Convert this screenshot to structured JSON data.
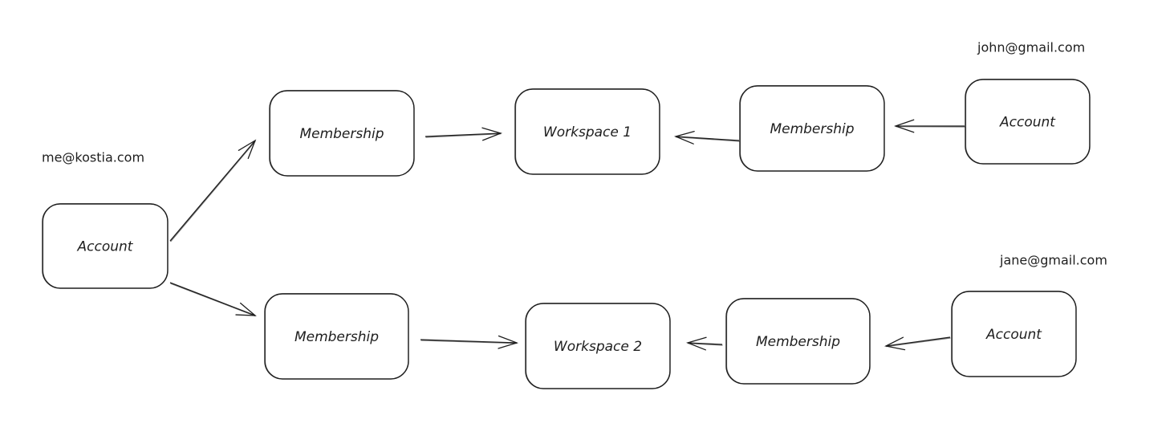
{
  "diagram": {
    "stroke_color": "#1e1e1e",
    "background": "#ffffff",
    "nodes": [
      {
        "id": "account-me",
        "label": "Account",
        "type": "account"
      },
      {
        "id": "membership-me-ws1",
        "label": "Membership",
        "type": "membership"
      },
      {
        "id": "workspace-1",
        "label": "Workspace 1",
        "type": "workspace"
      },
      {
        "id": "membership-john-ws1",
        "label": "Membership",
        "type": "membership"
      },
      {
        "id": "account-john",
        "label": "Account",
        "type": "account"
      },
      {
        "id": "membership-me-ws2",
        "label": "Membership",
        "type": "membership"
      },
      {
        "id": "workspace-2",
        "label": "Workspace 2",
        "type": "workspace"
      },
      {
        "id": "membership-jane-ws2",
        "label": "Membership",
        "type": "membership"
      },
      {
        "id": "account-jane",
        "label": "Account",
        "type": "account"
      }
    ],
    "annotations": [
      {
        "id": "email-me",
        "text": "me@kostia.com",
        "for": "account-me"
      },
      {
        "id": "email-john",
        "text": "john@gmail.com",
        "for": "account-john"
      },
      {
        "id": "email-jane",
        "text": "jane@gmail.com",
        "for": "account-jane"
      }
    ],
    "edges": [
      {
        "from": "account-me",
        "to": "membership-me-ws1"
      },
      {
        "from": "account-me",
        "to": "membership-me-ws2"
      },
      {
        "from": "membership-me-ws1",
        "to": "workspace-1"
      },
      {
        "from": "membership-me-ws2",
        "to": "workspace-2"
      },
      {
        "from": "account-john",
        "to": "membership-john-ws1"
      },
      {
        "from": "membership-john-ws1",
        "to": "workspace-1"
      },
      {
        "from": "account-jane",
        "to": "membership-jane-ws2"
      },
      {
        "from": "membership-jane-ws2",
        "to": "workspace-2"
      }
    ]
  }
}
